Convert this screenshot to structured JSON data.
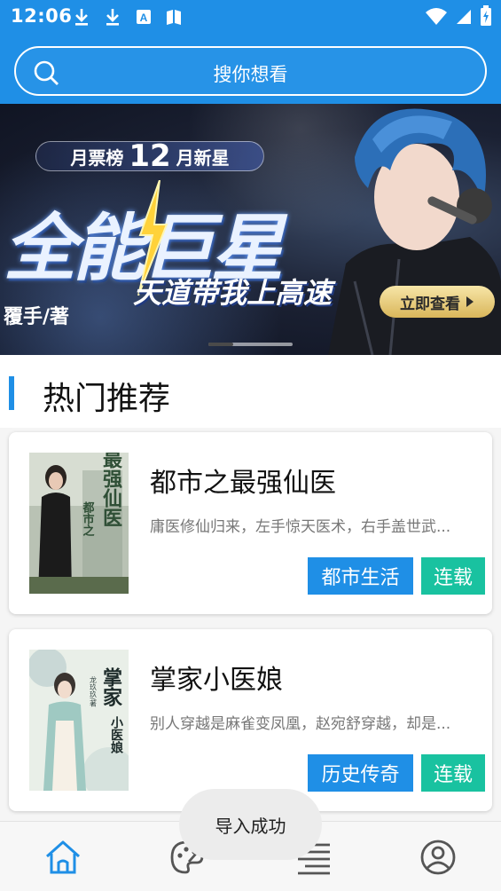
{
  "status_bar": {
    "time": "12:06",
    "icons": [
      "download-icon",
      "download-icon",
      "keyboard-a-icon",
      "book-icon",
      "wifi-icon",
      "signal-icon",
      "battery-icon"
    ]
  },
  "search": {
    "placeholder": "搜你想看"
  },
  "banner": {
    "tag_prefix": "月票榜",
    "tag_number": "12",
    "tag_suffix": "月新星",
    "headline": "全能巨星",
    "subtitle": "天道带我上高速",
    "author": "覆手/著",
    "cta_label": "立即查看",
    "page_count": 3,
    "active_page": 1
  },
  "section": {
    "title": "热门推荐"
  },
  "books": [
    {
      "title": "都市之最强仙医",
      "description": "庸医修仙归来，左手惊天医术，右手盖世武...",
      "genre": "都市生活",
      "status": "连载",
      "cover_text": "最强仙医",
      "cover_subtext": "都市之"
    },
    {
      "title": "掌家小医娘",
      "description": "别人穿越是麻雀变凤凰，赵宛舒穿越，却是...",
      "genre": "历史传奇",
      "status": "连载",
      "cover_text": "掌家小医娘",
      "cover_subtext": "龙玖玖/著"
    }
  ],
  "toast": {
    "message": "导入成功"
  },
  "bottom_nav": [
    {
      "icon": "home-icon",
      "active": true
    },
    {
      "icon": "palette-icon",
      "active": false
    },
    {
      "icon": "list-icon",
      "active": false
    },
    {
      "icon": "user-icon",
      "active": false
    }
  ],
  "colors": {
    "primary": "#1f8fe6",
    "teal": "#19c2a0"
  }
}
